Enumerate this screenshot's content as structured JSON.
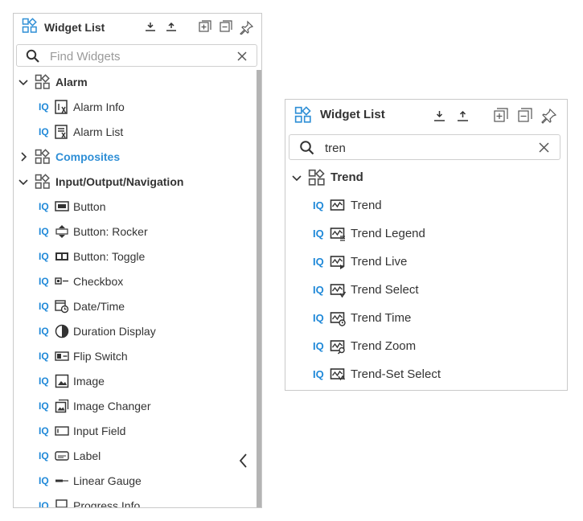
{
  "colors": {
    "accent": "#2f8fd6",
    "iq": "#1e88d8",
    "text": "#333333",
    "icon": "#4a4a4a"
  },
  "left": {
    "header": {
      "title": "Widget List"
    },
    "search": {
      "placeholder": "Find Widgets",
      "value": ""
    },
    "tree": {
      "alarm": {
        "label": "Alarm",
        "items": [
          "Alarm Info",
          "Alarm List"
        ]
      },
      "composites": {
        "label": "Composites"
      },
      "io": {
        "label": "Input/Output/Navigation",
        "items": [
          "Button",
          "Button: Rocker",
          "Button: Toggle",
          "Checkbox",
          "Date/Time",
          "Duration Display",
          "Flip Switch",
          "Image",
          "Image Changer",
          "Input Field",
          "Label",
          "Linear Gauge",
          "Progress Info"
        ]
      }
    }
  },
  "right": {
    "header": {
      "title": "Widget List"
    },
    "search": {
      "placeholder": "Find Widgets",
      "value": "tren"
    },
    "tree": {
      "trend": {
        "label": "Trend",
        "items": [
          "Trend",
          "Trend Legend",
          "Trend Live",
          "Trend Select",
          "Trend Time",
          "Trend Zoom",
          "Trend-Set Select"
        ]
      }
    }
  },
  "iq_badge": "IQ"
}
